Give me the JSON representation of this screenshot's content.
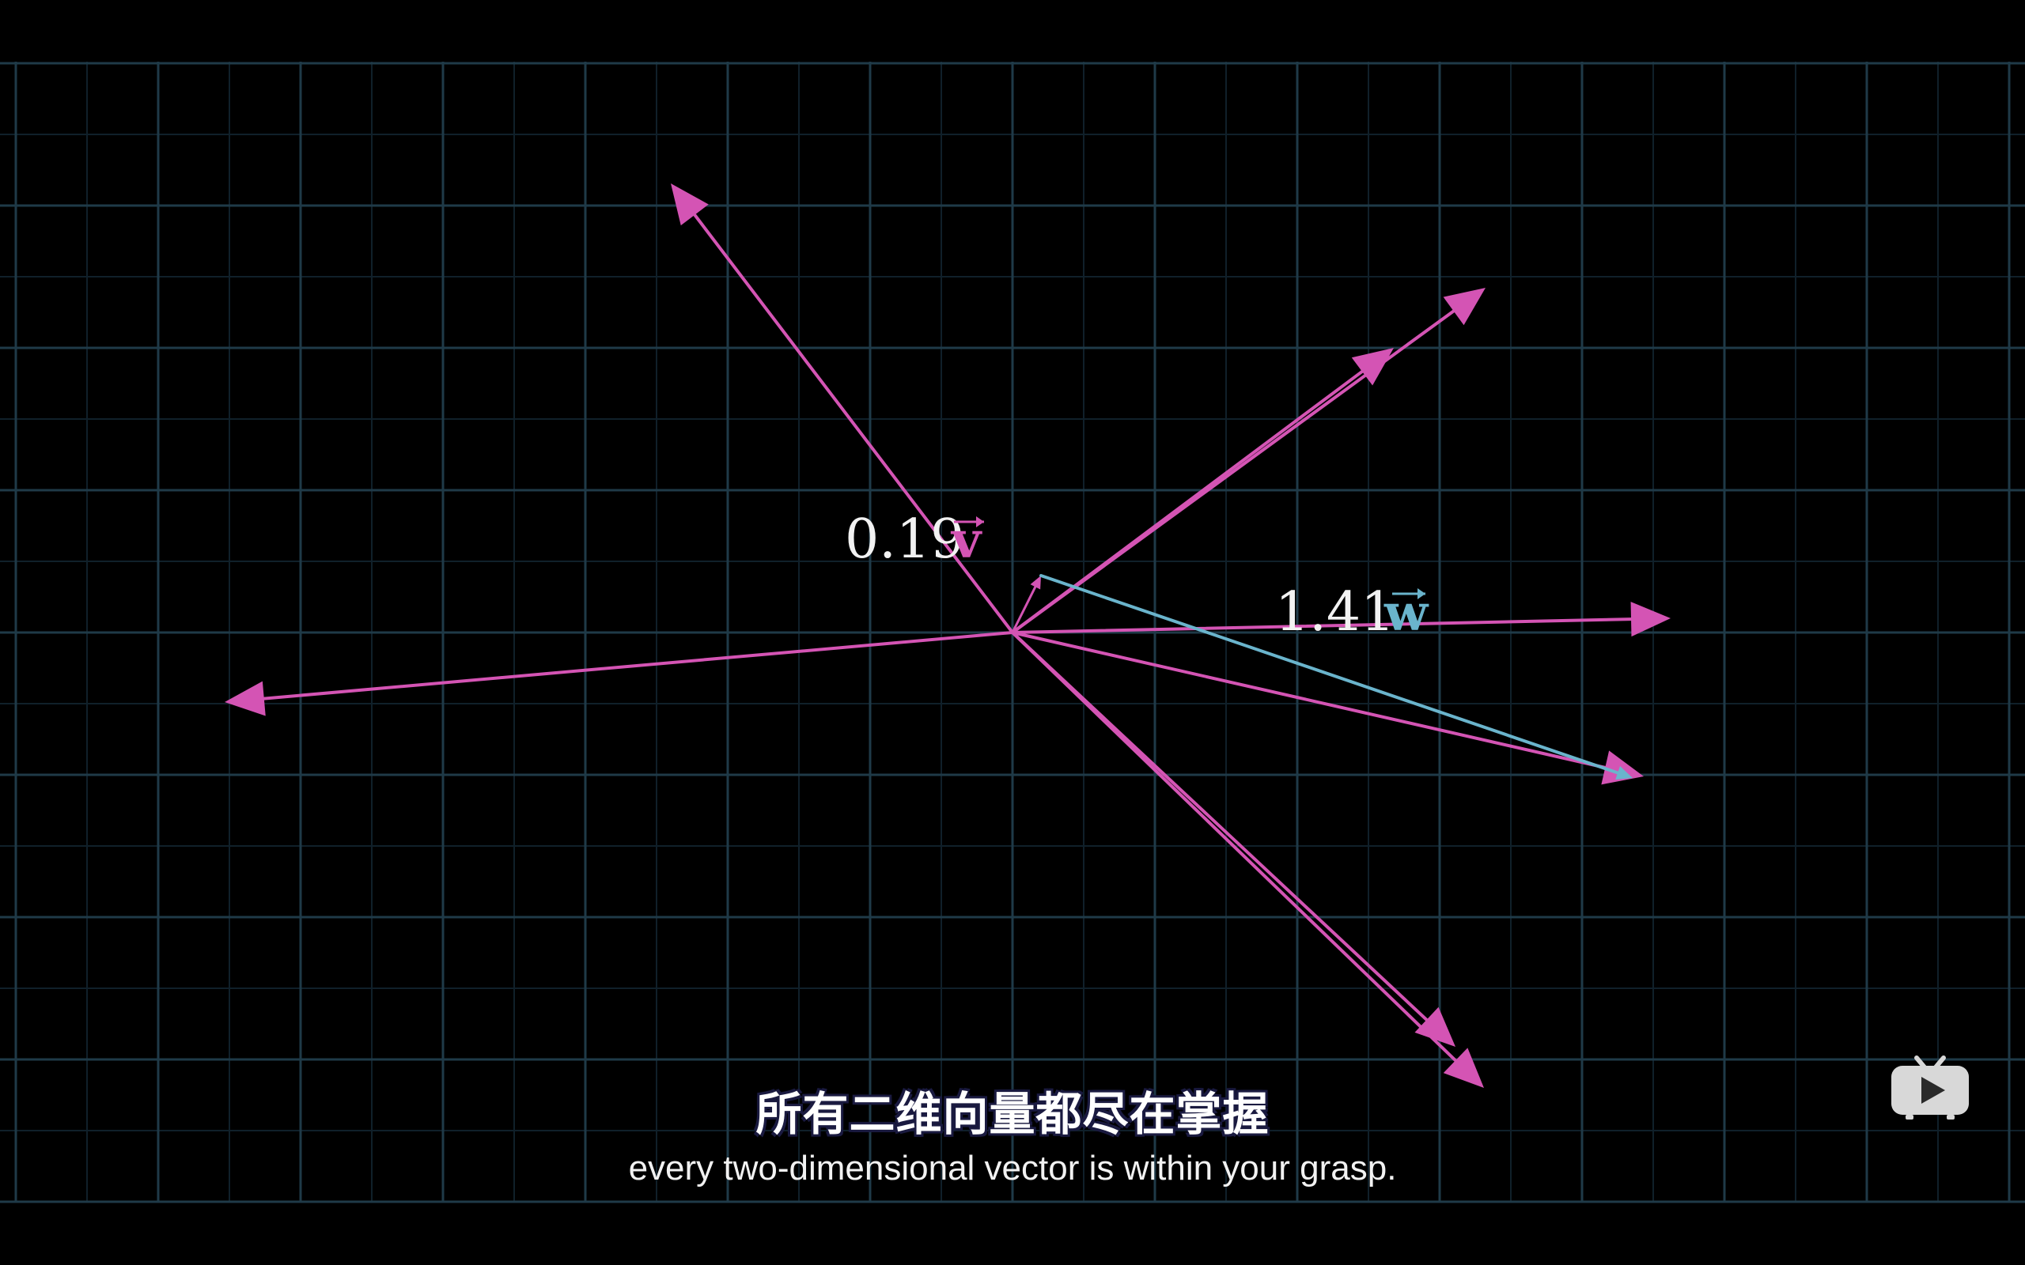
{
  "labels": {
    "v_coefficient": "0.19",
    "v_symbol": "v",
    "w_coefficient": "1.41",
    "w_symbol": "w"
  },
  "subtitle": {
    "chinese": "所有二维向量都尽在掌握",
    "english": "every two-dimensional vector is within your grasp."
  },
  "colors": {
    "background": "#000000",
    "grid_major": "#1f3a48",
    "grid_minor": "#10202a",
    "vector_pink": "#d454b4",
    "vector_blue": "#6ab4cc",
    "label_white": "#f2f2f2"
  },
  "icons": {
    "watermark": "bilibili-tv-icon"
  }
}
